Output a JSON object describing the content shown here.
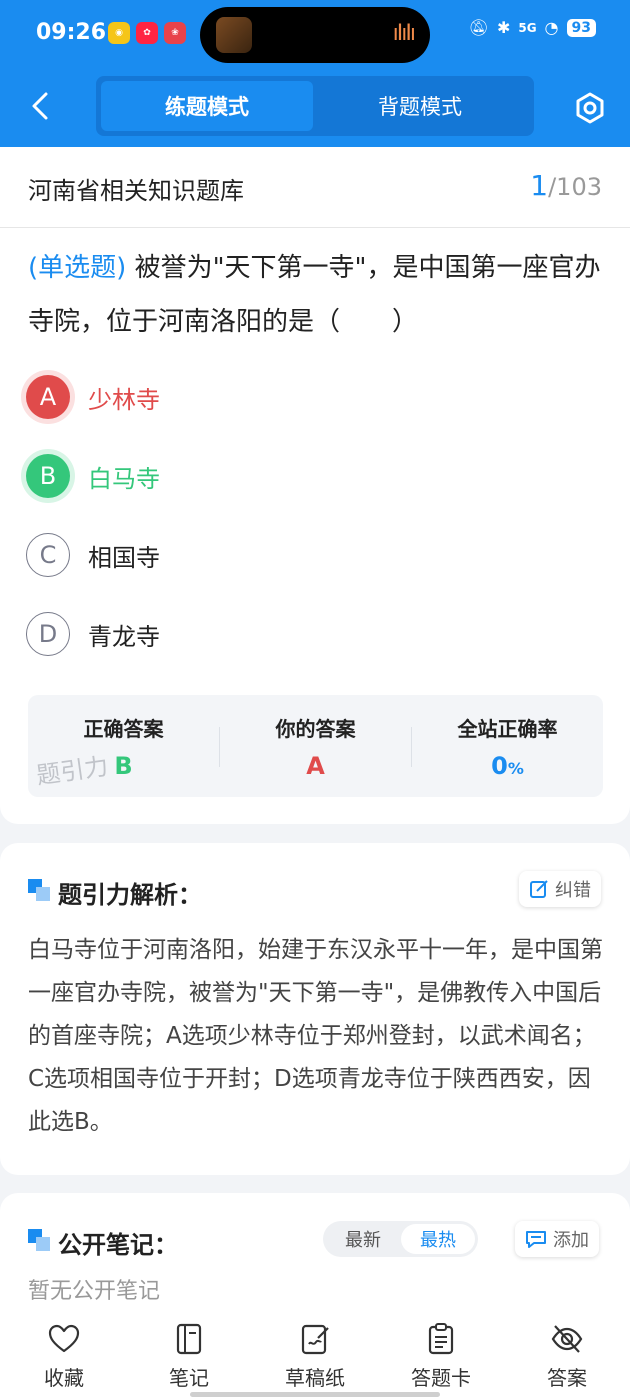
{
  "status_bar": {
    "time": "09:26",
    "app_badges": [
      "weibo-app",
      "xiaohongshu-app",
      "red-app"
    ],
    "battery": "93",
    "network": "5G"
  },
  "header": {
    "modes": [
      "练题模式",
      "背题模式"
    ],
    "active_mode": "练题模式"
  },
  "question_card": {
    "bank_title": "河南省相关知识题库",
    "progress_current": "1",
    "progress_total": "/103",
    "question_type": "(单选题)",
    "question_text": "被誉为\"天下第一寺\"，是中国第一座官办寺院，位于河南洛阳的是（　　）",
    "options": [
      {
        "letter": "A",
        "text": "少林寺",
        "state": "wrong"
      },
      {
        "letter": "B",
        "text": "白马寺",
        "state": "correct"
      },
      {
        "letter": "C",
        "text": "相国寺",
        "state": "normal"
      },
      {
        "letter": "D",
        "text": "青龙寺",
        "state": "normal"
      }
    ],
    "result": {
      "correct_label": "正确答案",
      "correct_value": "B",
      "yours_label": "你的答案",
      "yours_value": "A",
      "rate_label": "全站正确率",
      "rate_value": "0",
      "rate_unit": "%",
      "watermark": "题引力"
    },
    "colors": {
      "accent": "#1a8cf0",
      "wrong": "#e04b4b",
      "correct": "#34c77b"
    }
  },
  "analysis": {
    "title": "题引力解析：",
    "report_label": "纠错",
    "text": "白马寺位于河南洛阳，始建于东汉永平十一年，是中国第一座官办寺院，被誉为\"天下第一寺\"，是佛教传入中国后的首座寺院；A选项少林寺位于郑州登封，以武术闻名；C选项相国寺位于开封；D选项青龙寺位于陕西西安，因此选B。"
  },
  "notes": {
    "title": "公开笔记：",
    "sort_options": [
      "最新",
      "最热"
    ],
    "active_sort": "最热",
    "add_label": "添加",
    "empty_text": "暂无公开笔记"
  },
  "bottom_nav": {
    "items": [
      {
        "label": "收藏",
        "icon": "heart-icon"
      },
      {
        "label": "笔记",
        "icon": "notebook-icon"
      },
      {
        "label": "草稿纸",
        "icon": "draft-paper-icon"
      },
      {
        "label": "答题卡",
        "icon": "answer-sheet-icon"
      },
      {
        "label": "答案",
        "icon": "eye-off-icon"
      }
    ]
  }
}
